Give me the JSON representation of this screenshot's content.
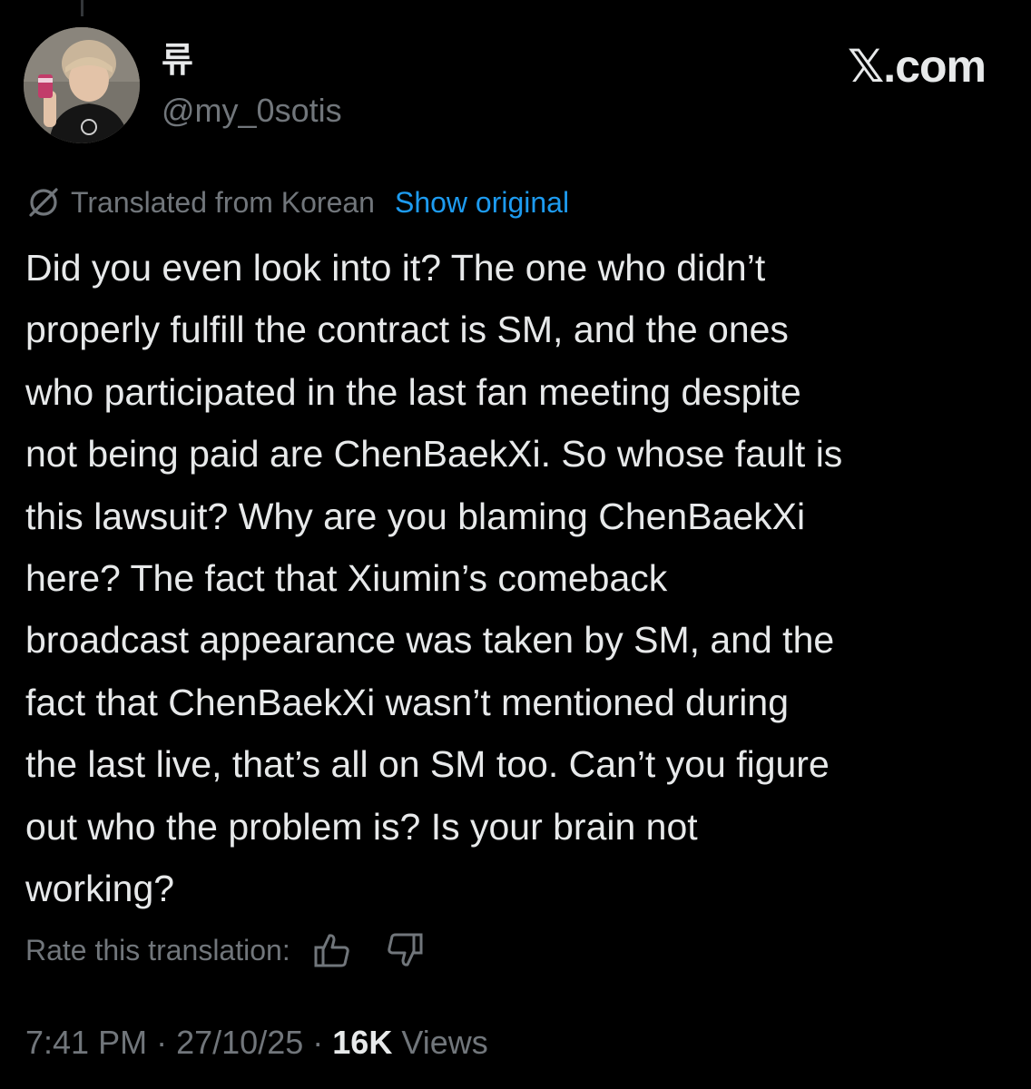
{
  "tweet": {
    "author": {
      "name": "류",
      "handle": "@my_0sotis",
      "avatar_icon": "profile-photo"
    },
    "brand": "𝕏.com",
    "translation": {
      "icon": "translate-globe-icon",
      "label": "Translated from Korean",
      "show_original": "Show original"
    },
    "text": "Did you even look into it? The one who didn’t\nproperly fulfill the contract is SM, and the ones\nwho participated in the last fan meeting despite\nnot being paid are ChenBaekXi. So whose fault is\nthis lawsuit? Why are you blaming ChenBaekXi\nhere? The fact that Xiumin’s comeback\nbroadcast appearance was taken by SM, and the\nfact that ChenBaekXi wasn’t mentioned during\nthe last live, that’s all on SM too. Can’t you figure\nout who the problem is? Is your brain not\nworking?",
    "rate": {
      "label": "Rate this translation:",
      "thumbs_up_icon": "thumbs-up-icon",
      "thumbs_down_icon": "thumbs-down-icon"
    },
    "meta": {
      "time": "7:41 PM",
      "separator": "·",
      "date": "27/10/25",
      "views_count": "16K",
      "views_label": "Views"
    }
  },
  "colors": {
    "background": "#000000",
    "primary_text": "#e7e9ea",
    "secondary_text": "#71767b",
    "link": "#1d9bf0"
  }
}
